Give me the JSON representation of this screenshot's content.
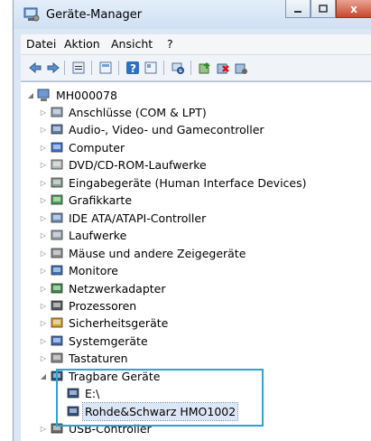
{
  "window": {
    "title": "Geräte-Manager",
    "close_glyph": "x"
  },
  "menu": {
    "items": [
      "Datei",
      "Aktion",
      "Ansicht",
      "?"
    ]
  },
  "toolbar": {
    "icons": [
      "back-icon",
      "forward-icon",
      "properties-icon",
      "console-icon",
      "help-icon",
      "view-icon",
      "scan-icon",
      "update-driver-icon",
      "uninstall-icon",
      "disable-icon"
    ]
  },
  "tree": {
    "root": "MH000078",
    "categories": [
      "Anschlüsse (COM & LPT)",
      "Audio-, Video- und Gamecontroller",
      "Computer",
      "DVD/CD-ROM-Laufwerke",
      "Eingabegeräte (Human Interface Devices)",
      "Grafikkarte",
      "IDE ATA/ATAPI-Controller",
      "Laufwerke",
      "Mäuse und andere Zeigegeräte",
      "Monitore",
      "Netzwerkadapter",
      "Prozessoren",
      "Sicherheitsgeräte",
      "Systemgeräte",
      "Tastaturen",
      "Tragbare Geräte"
    ],
    "portable_children": [
      "E:\\",
      "Rohde&Schwarz HMO1002"
    ],
    "last": "USB-Controller"
  }
}
